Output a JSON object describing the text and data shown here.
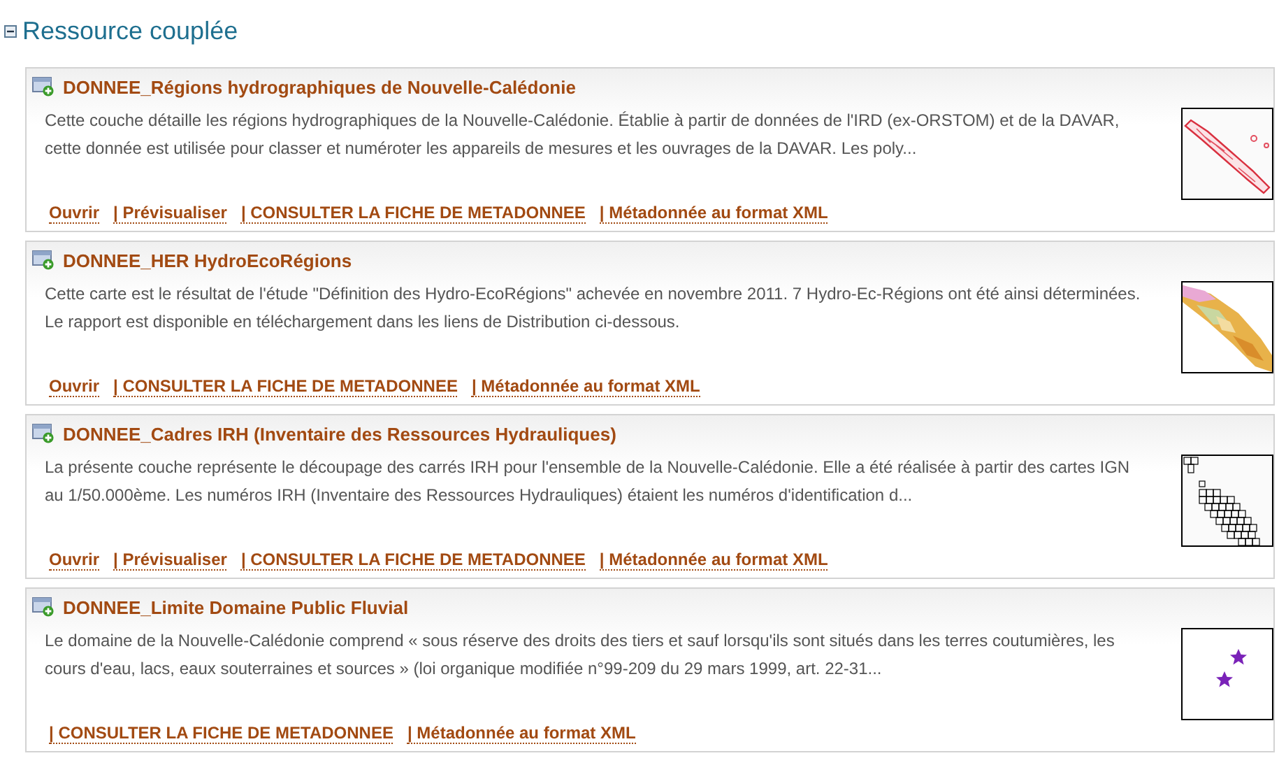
{
  "section": {
    "title": "Ressource couplée",
    "expanded": true
  },
  "resources": [
    {
      "title": "DONNEE_Régions hydrographiques de Nouvelle-Calédonie",
      "description": "Cette couche détaille les régions hydrographiques de la Nouvelle-Calédonie. Établie à partir de données de l'IRD (ex-ORSTOM) et de la DAVAR, cette donnée est utilisée pour classer et numéroter les appareils de mesures et les ouvrages de la DAVAR. Les poly...",
      "thumbnail": {
        "kind": "outline"
      },
      "links": [
        "Ouvrir",
        "| Prévisualiser",
        "| CONSULTER LA FICHE DE METADONNEE",
        "| Métadonnée au format XML"
      ]
    },
    {
      "title": "DONNEE_HER HydroEcoRégions",
      "description": "Cette carte est le résultat de l'étude \"Définition des Hydro-EcoRégions\" achevée en novembre 2011. 7 Hydro-Ec-Régions ont été ainsi déterminées. Le rapport est disponible en téléchargement dans les liens de Distribution ci-dessous.",
      "thumbnail": {
        "kind": "zones"
      },
      "links": [
        "Ouvrir",
        "| CONSULTER LA FICHE DE METADONNEE",
        "| Métadonnée au format XML"
      ]
    },
    {
      "title": "DONNEE_Cadres IRH (Inventaire des Ressources Hydrauliques)",
      "description": "La présente couche représente le découpage des carrés IRH pour l'ensemble de la Nouvelle-Calédonie. Elle a été réalisée à partir des cartes IGN au 1/50.000ème. Les numéros IRH (Inventaire des Ressources Hydrauliques) étaient les numéros d'identification d...",
      "thumbnail": {
        "kind": "grid"
      },
      "links": [
        "Ouvrir",
        "| Prévisualiser",
        "| CONSULTER LA FICHE DE METADONNEE",
        "| Métadonnée au format XML"
      ]
    },
    {
      "title": "DONNEE_Limite Domaine Public Fluvial",
      "description": "Le domaine de la Nouvelle-Calédonie comprend « sous réserve des droits des tiers et sauf lorsqu'ils sont situés dans les terres coutumières, les cours d'eau, lacs, eaux souterraines et sources » (loi organique modifiée n°99-209 du 29 mars 1999, art. 22-31...",
      "thumbnail": {
        "kind": "points"
      },
      "links": [
        "| CONSULTER LA FICHE DE METADONNEE",
        "| Métadonnée au format XML"
      ]
    }
  ]
}
